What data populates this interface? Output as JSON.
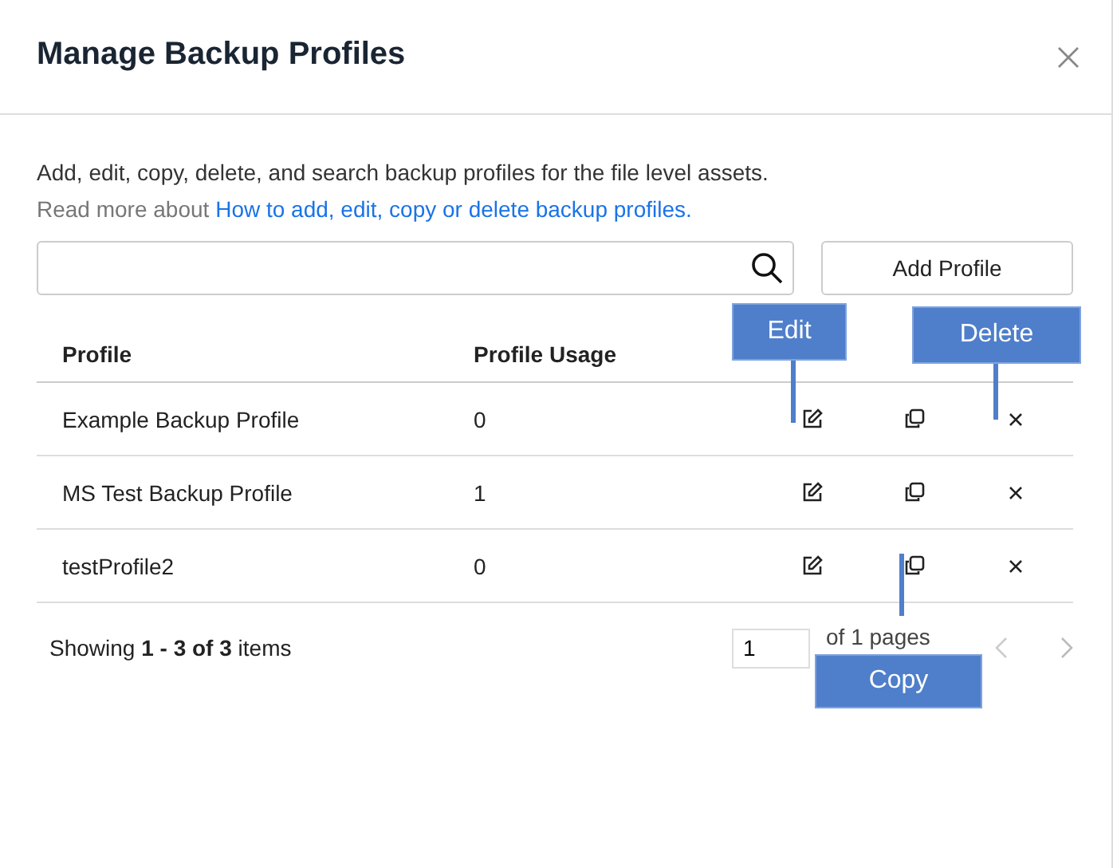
{
  "dialog": {
    "title": "Manage Backup Profiles",
    "description": "Add, edit, copy, delete, and search backup profiles for the file level assets.",
    "read_more": {
      "prefix": "Read more about",
      "link": "How to add, edit, copy or delete backup profiles."
    }
  },
  "toolbar": {
    "add_button": "Add Profile"
  },
  "table": {
    "columns": [
      "Profile",
      "Profile Usage"
    ],
    "rows": [
      {
        "profile": "Example Backup Profile",
        "usage": "0"
      },
      {
        "profile": "MS Test Backup Profile",
        "usage": "1"
      },
      {
        "profile": "testProfile2",
        "usage": "0"
      }
    ]
  },
  "footer": {
    "summary": "Showing **1 - 3 of 3** items",
    "page": "1",
    "pages_label": "of 1 pages"
  },
  "callouts": [
    {
      "label": "Edit"
    },
    {
      "label": "Delete"
    },
    {
      "label": "Copy"
    }
  ]
}
